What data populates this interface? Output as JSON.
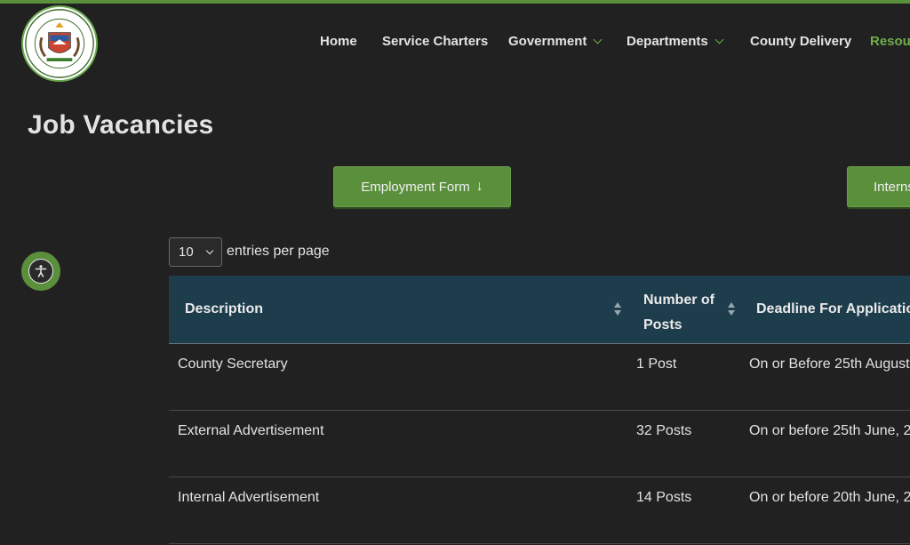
{
  "header": {
    "logo_text": "COUNTY GOVERNMENT OF NYERI",
    "nav": [
      {
        "label": "Home",
        "dropdown": false,
        "active": false
      },
      {
        "label": "Service Charters",
        "dropdown": false,
        "active": false
      },
      {
        "label": "Government",
        "dropdown": true,
        "active": false
      },
      {
        "label": "Departments",
        "dropdown": true,
        "active": false
      },
      {
        "label": "County Delivery",
        "dropdown": false,
        "active": false
      },
      {
        "label": "Resou",
        "dropdown": false,
        "active": true
      }
    ]
  },
  "page": {
    "title": "Job Vacancies",
    "employment_button": "Employment Form",
    "intern_button": "Interns"
  },
  "table_controls": {
    "entries_value": "10",
    "entries_label": "entries per page"
  },
  "table": {
    "headers": [
      "Description",
      "Number of Posts",
      "Deadline For Application"
    ],
    "headers_split": {
      "posts_line1": "Number of",
      "posts_line2": "Posts"
    },
    "rows": [
      {
        "description": "County Secretary",
        "posts": "1 Post",
        "deadline": "On or Before 25th August"
      },
      {
        "description": "External Advertisement",
        "posts": "32 Posts",
        "deadline": "On or before 25th June, 2"
      },
      {
        "description": "Internal Advertisement",
        "posts": "14 Posts",
        "deadline": "On or before 20th June, 2"
      }
    ]
  },
  "colors": {
    "accent_green": "#5a8f3c",
    "table_header": "#1d3c4c",
    "background": "#212121"
  },
  "icons": {
    "accessibility": "accessibility-icon",
    "download_arrow": "arrow-down-icon"
  }
}
